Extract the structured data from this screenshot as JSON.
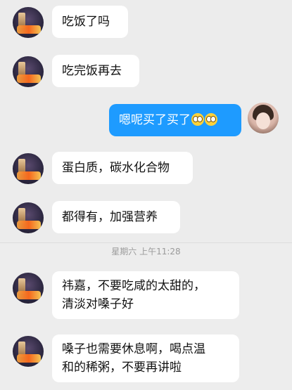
{
  "timestamp": "星期六 上午11:28",
  "messages_top": [
    {
      "sender": "friend",
      "text": "吃饭了吗"
    },
    {
      "sender": "friend",
      "text": "吃完饭再去"
    },
    {
      "sender": "self",
      "text": "嗯呢买了买了",
      "emoji": [
        "bashful-face-emoji",
        "bashful-face-emoji"
      ]
    },
    {
      "sender": "friend",
      "text": "蛋白质，碳水化合物"
    },
    {
      "sender": "friend",
      "text": "都得有，加强营养"
    }
  ],
  "messages_bottom": [
    {
      "sender": "friend",
      "lines": [
        "祎嘉，不要吃咸的太甜的，",
        "清淡对嗓子好"
      ]
    },
    {
      "sender": "friend",
      "lines": [
        "嗓子也需要休息啊，喝点温",
        "和的稀粥，不要再讲啦"
      ]
    }
  ],
  "colors": {
    "background": "#ececec",
    "self_bubble": "#1e9bff",
    "friend_bubble": "#ffffff",
    "timestamp": "#9a9a9a"
  }
}
